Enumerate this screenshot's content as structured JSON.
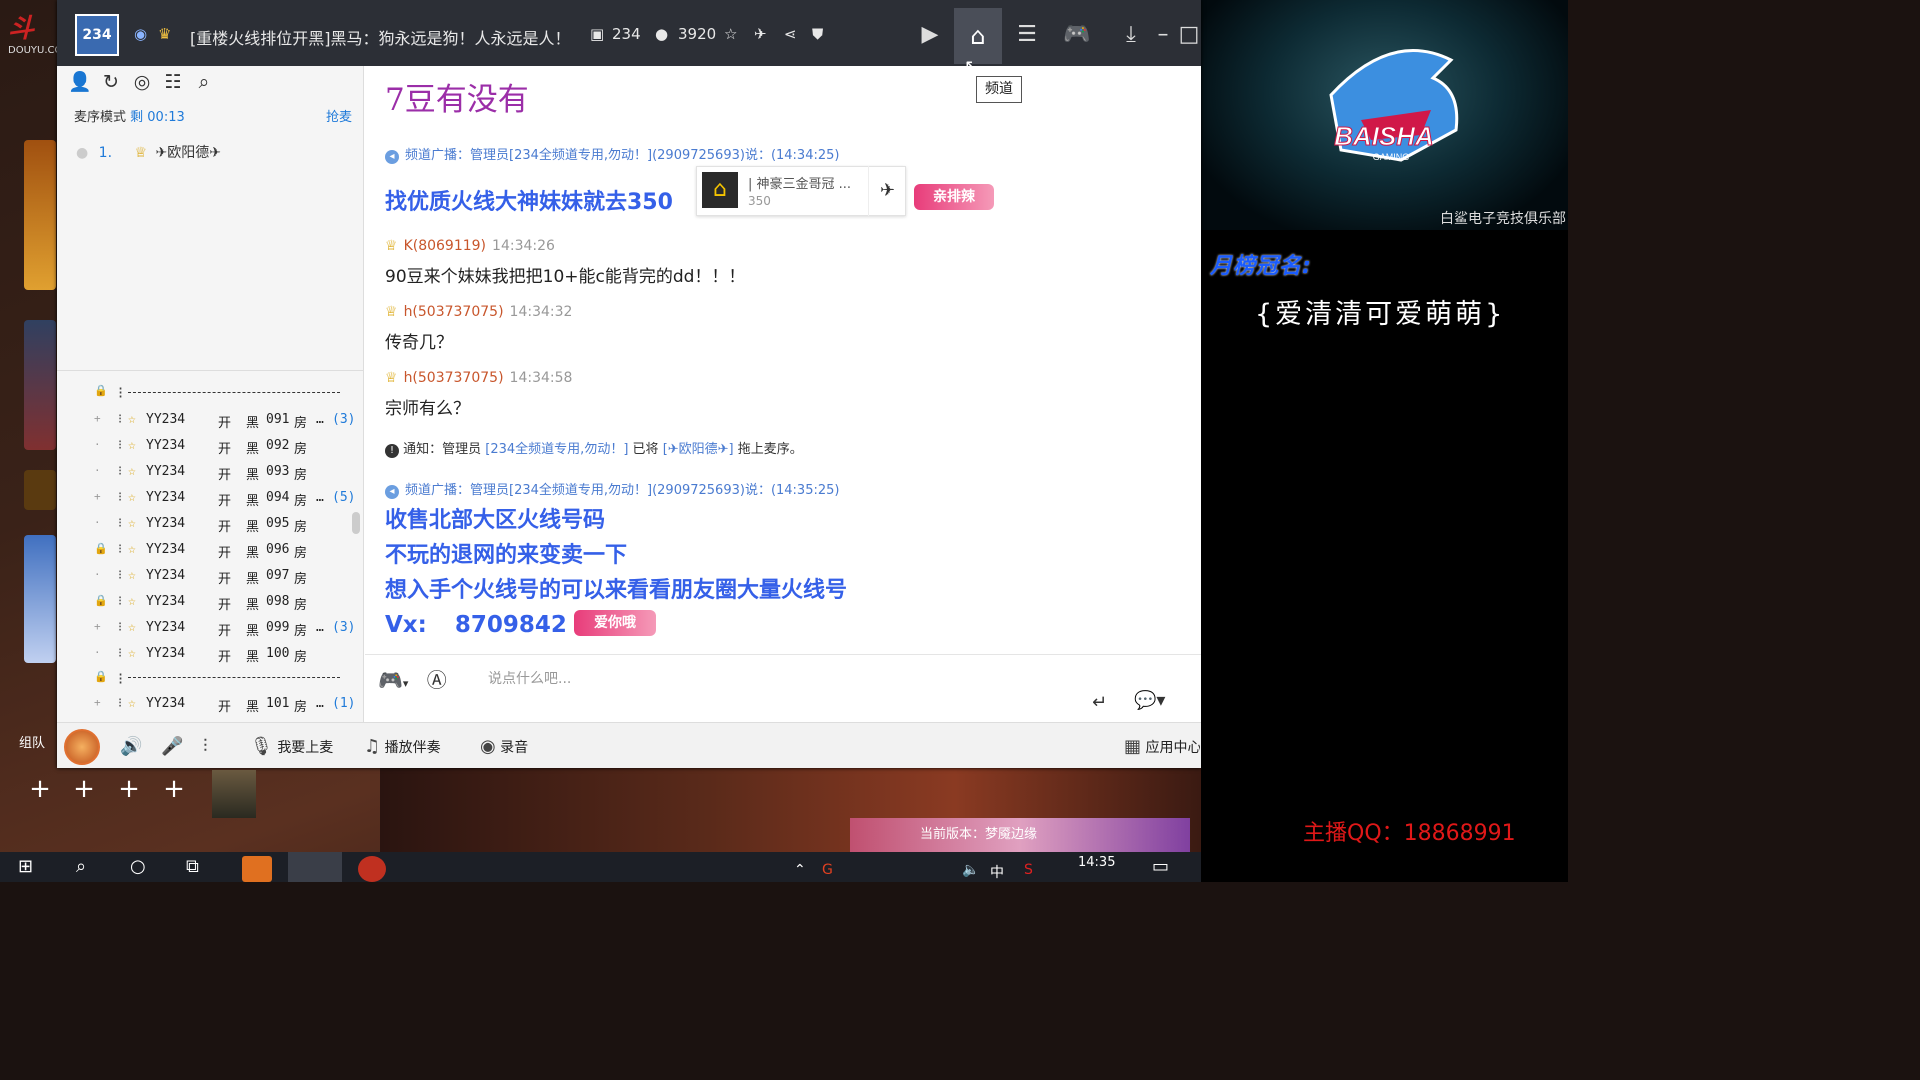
{
  "window": {
    "channel_id": "234",
    "channel_title": "[重楼火线排位开黑]黑马：狗永远是狗！人永远是人！",
    "id_count": "234",
    "user_count": "3920",
    "tooltip": "频道"
  },
  "left_pane": {
    "mic_mode_label": "麦序模式",
    "mic_timer": "剩 00:13",
    "grab_mic": "抢麦",
    "queue": [
      {
        "index": "1.",
        "name": "✈欧阳德✈"
      }
    ],
    "rooms": [
      {
        "name": "YY234",
        "kai": "开",
        "hei": "黑",
        "num": "091",
        "fang": "房",
        "dots": "…",
        "count": "(3)",
        "exp": "+"
      },
      {
        "name": "YY234",
        "kai": "开",
        "hei": "黑",
        "num": "092",
        "fang": "房",
        "dots": "",
        "count": "",
        "exp": "·"
      },
      {
        "name": "YY234",
        "kai": "开",
        "hei": "黑",
        "num": "093",
        "fang": "房",
        "dots": "",
        "count": "",
        "exp": "·"
      },
      {
        "name": "YY234",
        "kai": "开",
        "hei": "黑",
        "num": "094",
        "fang": "房",
        "dots": "…",
        "count": "(5)",
        "exp": "+"
      },
      {
        "name": "YY234",
        "kai": "开",
        "hei": "黑",
        "num": "095",
        "fang": "房",
        "dots": "",
        "count": "",
        "exp": "·"
      },
      {
        "name": "YY234",
        "kai": "开",
        "hei": "黑",
        "num": "096",
        "fang": "房",
        "dots": "",
        "count": "",
        "exp": "🔒"
      },
      {
        "name": "YY234",
        "kai": "开",
        "hei": "黑",
        "num": "097",
        "fang": "房",
        "dots": "",
        "count": "",
        "exp": "·"
      },
      {
        "name": "YY234",
        "kai": "开",
        "hei": "黑",
        "num": "098",
        "fang": "房",
        "dots": "",
        "count": "",
        "exp": "🔒"
      },
      {
        "name": "YY234",
        "kai": "开",
        "hei": "黑",
        "num": "099",
        "fang": "房",
        "dots": "…",
        "count": "(3)",
        "exp": "+"
      },
      {
        "name": "YY234",
        "kai": "开",
        "hei": "黑",
        "num": "100",
        "fang": "房",
        "dots": "",
        "count": "",
        "exp": "·"
      },
      {
        "name": "YY234",
        "kai": "开",
        "hei": "黑",
        "num": "101",
        "fang": "房",
        "dots": "…",
        "count": "(1)",
        "exp": "+"
      }
    ]
  },
  "chat": {
    "heading": "7豆有没有",
    "broadcast_1": "频道广播：管理员[234全频道专用,勿动！](2909725693)说：(14:34:25)",
    "broadcast_1_text": "找优质火线大神妹妹就去350",
    "share_card_title": "| 神豪三金哥冠 ...",
    "share_card_num": "350",
    "sticker_1": "亲排辣",
    "messages": [
      {
        "nick": "K(8069119)",
        "time": "14:34:26",
        "text": "90豆来个妹妹我把把10+能c能背完的dd！！！"
      },
      {
        "nick": "h(503737075)",
        "time": "14:34:32",
        "text": "传奇几？"
      },
      {
        "nick": "h(503737075)",
        "time": "14:34:58",
        "text": "宗师有么？"
      }
    ],
    "notice_prefix": "通知：管理员",
    "notice_admin": "[234全频道专用,勿动！]",
    "notice_mid": "已将",
    "notice_user": "[✈欧阳德✈]",
    "notice_suffix": "拖上麦序。",
    "broadcast_2": "频道广播：管理员[234全频道专用,勿动！](2909725693)说：(14:35:25)",
    "broadcast_2_lines": [
      "收售北部大区火线号码",
      "不玩的退网的来变卖一下",
      "想入手个火线号的可以来看看朋友圈大量火线号"
    ],
    "vx_label": "Vx:",
    "vx_number": "8709842",
    "sticker_2": "爱你哦"
  },
  "input": {
    "placeholder": "说点什么吧..."
  },
  "bottom_bar": {
    "mic_up": "我要上麦",
    "play_music": "播放伴奏",
    "record": "录音",
    "apps": "应用中心"
  },
  "stream_overlay": {
    "club_name": "白鲨电子竞技俱乐部",
    "logo_text": "BAISHA",
    "logo_sub": "GAMING",
    "monthly_title": "月榜冠名:",
    "monthly_name": "{爱清清可爱萌萌}",
    "host_qq": "主播QQ：18868991",
    "team_label": "组队",
    "version_banner": "当前版本：梦魇边缘",
    "douyu": "DOUYU.COM"
  },
  "taskbar": {
    "time": "14:35",
    "ime": "中"
  },
  "colors": {
    "accent_blue": "#3560e8",
    "heading_purple": "#9b2ea8",
    "nick_orange": "#c8562c",
    "host_qq_red": "#e01818"
  }
}
